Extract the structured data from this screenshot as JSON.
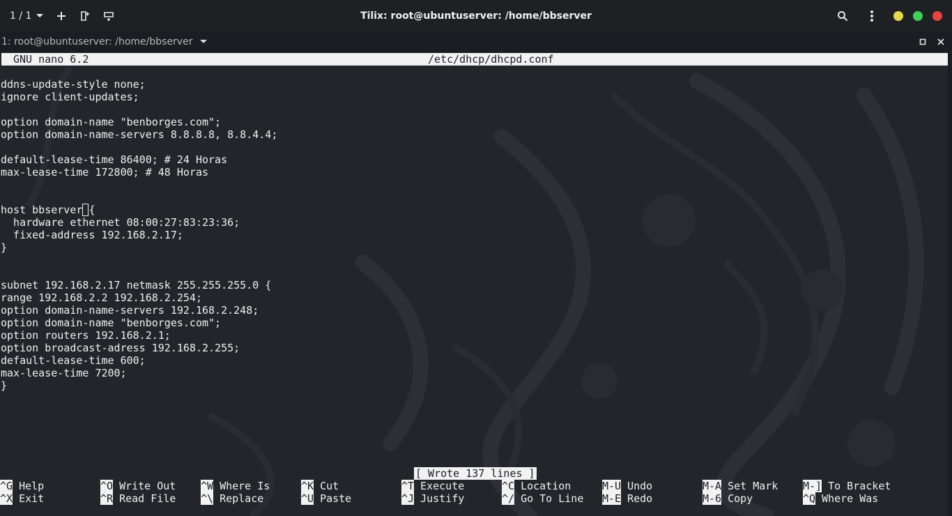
{
  "titlebar": {
    "session_counter": "1 / 1",
    "title": "Tilix: root@ubuntuserver: /home/bbserver",
    "colors": {
      "minimize": "#e6d84a",
      "maximize": "#3fcf5a",
      "close": "#e8433f"
    }
  },
  "terminal_tab": {
    "title": "1: root@ubuntuserver: /home/bbserver"
  },
  "nano": {
    "version": "GNU nano 6.2",
    "filename": "/etc/dhcp/dhcpd.conf",
    "lines": [
      "",
      "ddns-update-style none;",
      "ignore client-updates;",
      "",
      "option domain-name \"benborges.com\";",
      "option domain-name-servers 8.8.8.8, 8.8.4.4;",
      "",
      "default-lease-time 86400; # 24 Horas",
      "max-lease-time 172800; # 48 Horas",
      "",
      "",
      "host bbserver {",
      "  hardware ethernet 08:00:27:83:23:36;",
      "  fixed-address 192.168.2.17;",
      "}",
      "",
      "",
      "subnet 192.168.2.17 netmask 255.255.255.0 {",
      "range 192.168.2.2 192.168.2.254;",
      "option domain-name-servers 192.168.2.248;",
      "option domain-name \"benborges.com\";",
      "option routers 192.168.2.1;",
      "option broadcast-adress 192.168.2.255;",
      "default-lease-time 600;",
      "max-lease-time 7200;",
      "}"
    ],
    "status_message": "[ Wrote 137 lines ]",
    "shortcuts": [
      [
        {
          "key": "^G",
          "label": "Help"
        },
        {
          "key": "^X",
          "label": "Exit"
        }
      ],
      [
        {
          "key": "^O",
          "label": "Write Out"
        },
        {
          "key": "^R",
          "label": "Read File"
        }
      ],
      [
        {
          "key": "^W",
          "label": "Where Is"
        },
        {
          "key": "^\\",
          "label": "Replace"
        }
      ],
      [
        {
          "key": "^K",
          "label": "Cut"
        },
        {
          "key": "^U",
          "label": "Paste"
        }
      ],
      [
        {
          "key": "^T",
          "label": "Execute"
        },
        {
          "key": "^J",
          "label": "Justify"
        }
      ],
      [
        {
          "key": "^C",
          "label": "Location"
        },
        {
          "key": "^/",
          "label": "Go To Line"
        }
      ],
      [
        {
          "key": "M-U",
          "label": "Undo"
        },
        {
          "key": "M-E",
          "label": "Redo"
        }
      ],
      [
        {
          "key": "M-A",
          "label": "Set Mark"
        },
        {
          "key": "M-6",
          "label": "Copy"
        }
      ],
      [
        {
          "key": "M-]",
          "label": "To Bracket"
        },
        {
          "key": "^Q",
          "label": "Where Was"
        }
      ]
    ]
  }
}
